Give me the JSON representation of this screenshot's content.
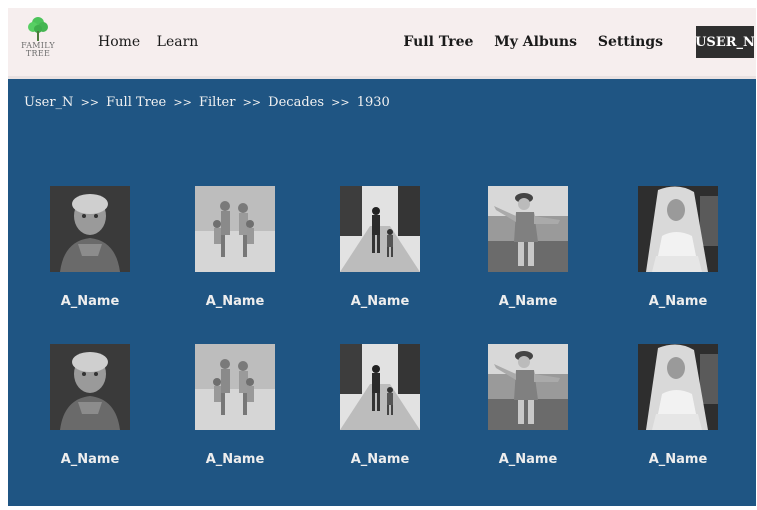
{
  "header": {
    "logo_text_line1": "FAMILY",
    "logo_text_line2": "TREE",
    "nav_left": [
      "Home",
      "Learn"
    ],
    "nav_right": [
      "Full Tree",
      "My Albuns",
      "Settings"
    ],
    "user_button": "USER_N"
  },
  "breadcrumb": {
    "items": [
      "User_N",
      "Full Tree",
      "Filter",
      "Decades",
      "1930"
    ],
    "separator": ">>"
  },
  "photos": [
    {
      "name": "A_Name",
      "icon": "elderly-woman-photo"
    },
    {
      "name": "A_Name",
      "icon": "family-beach-photo"
    },
    {
      "name": "A_Name",
      "icon": "father-child-walking-photo"
    },
    {
      "name": "A_Name",
      "icon": "child-playing-photo"
    },
    {
      "name": "A_Name",
      "icon": "bride-veil-photo"
    },
    {
      "name": "A_Name",
      "icon": "elderly-woman-photo"
    },
    {
      "name": "A_Name",
      "icon": "family-beach-photo"
    },
    {
      "name": "A_Name",
      "icon": "father-child-walking-photo"
    },
    {
      "name": "A_Name",
      "icon": "child-playing-photo"
    },
    {
      "name": "A_Name",
      "icon": "bride-veil-photo"
    }
  ],
  "colors": {
    "header_bg": "#f6eeee",
    "main_bg": "#1f5583",
    "user_button_bg": "#2f2f2f",
    "logo_green": "#4cc35a"
  }
}
